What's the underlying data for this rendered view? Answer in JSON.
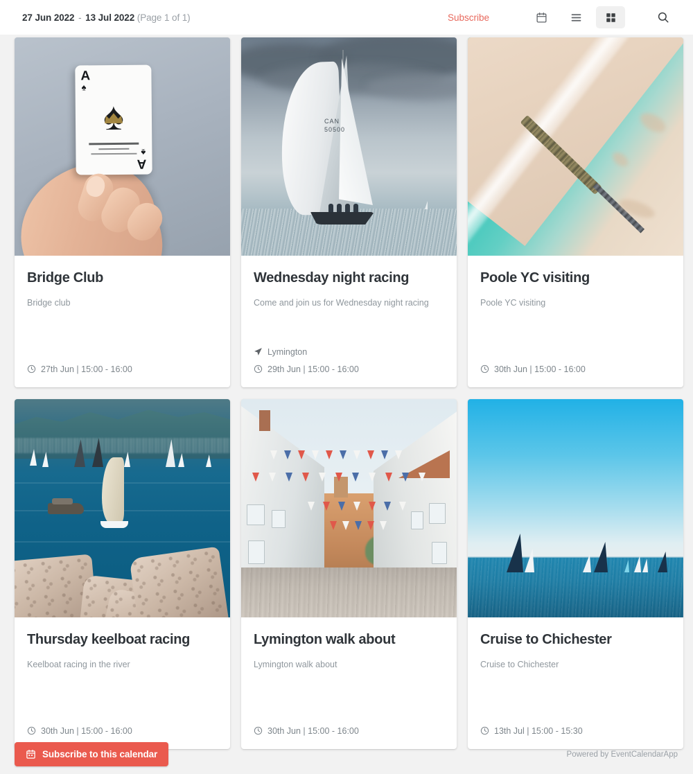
{
  "header": {
    "date_start": "27 Jun 2022",
    "date_separator": "-",
    "date_end": "13 Jul 2022",
    "page_info": "(Page 1 of 1)",
    "subscribe_label": "Subscribe",
    "views": [
      {
        "name": "calendar-view",
        "icon": "calendar-icon",
        "active": false
      },
      {
        "name": "list-view",
        "icon": "list-icon",
        "active": false
      },
      {
        "name": "grid-view",
        "icon": "grid-icon",
        "active": true
      }
    ],
    "search_icon": "search-icon",
    "accent_color": "#e8685c",
    "active_view_bg": "#f0f0f0"
  },
  "events": [
    {
      "title": "Bridge Club",
      "description": "Bridge club",
      "location": "",
      "datetime": "27th Jun | 15:00 - 16:00",
      "image_alt": "hand-holding-ace-of-spades-card"
    },
    {
      "title": "Wednesday night racing",
      "description": "Come and join us for Wednesday night racing",
      "location": "Lymington",
      "datetime": "29th Jun | 15:00 - 16:00",
      "image_alt": "racing-sailboat-under-cloudy-sky"
    },
    {
      "title": "Poole YC visiting",
      "description": "Poole YC visiting",
      "location": "",
      "datetime": "30th Jun | 15:00 - 16:00",
      "image_alt": "aerial-view-beach-groyne-turquoise-sea"
    },
    {
      "title": "Thursday keelboat racing",
      "description": "Keelboat racing in the river",
      "location": "",
      "datetime": "30th Jun | 15:00 - 16:00",
      "image_alt": "sailboats-on-blue-bay-with-rocks"
    },
    {
      "title": "Lymington walk about",
      "description": "Lymington walk about",
      "location": "",
      "datetime": "30th Jun | 15:00 - 16:00",
      "image_alt": "cobbled-street-with-bunting-flags"
    },
    {
      "title": "Cruise to Chichester",
      "description": "Cruise to Chichester",
      "location": "",
      "datetime": "13th Jul | 15:00 - 15:30",
      "image_alt": "distant-sailboats-on-calm-blue-sea"
    }
  ],
  "footer": {
    "subscribe_button_label": "Subscribe to this calendar",
    "subscribe_button_icon": "calendar-icon",
    "subscribe_button_color": "#ea5a4e",
    "powered_by": "Powered by EventCalendarApp"
  }
}
